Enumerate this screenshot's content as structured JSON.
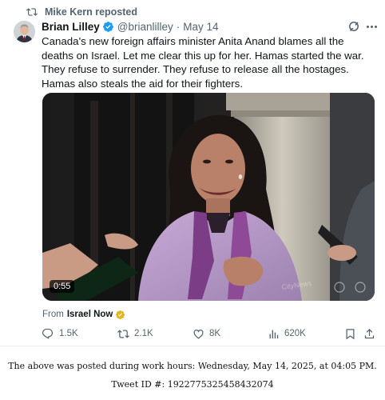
{
  "repost": {
    "label": "Mike Kern reposted"
  },
  "author": {
    "name": "Brian Lilley",
    "handle": "@brianlilley",
    "separator": "·",
    "date": "May 14"
  },
  "tweet": {
    "text": "Canada's new foreign affairs minister Anita Anand blames all the deaths on Israel. Let me clear this up for her. Hamas started the war. They refuse to surrender. They refuse to release all the hostages. Hamas also steals the aid for their fighters."
  },
  "video": {
    "duration": "0:55"
  },
  "source": {
    "prefix": "From",
    "name": "Israel Now"
  },
  "actions": {
    "replies": "1.5K",
    "reposts": "2.1K",
    "likes": "8K",
    "views": "620K"
  },
  "footer": {
    "line1": "The above was posted during work hours: Wednesday, May 14, 2025, at 04:05 PM.",
    "line2": "Tweet ID #: 1922775325458432074"
  },
  "colors": {
    "accent": "#1d9bf0",
    "muted": "#536471",
    "text": "#0f1419",
    "gold_badge": "#e2b719"
  }
}
